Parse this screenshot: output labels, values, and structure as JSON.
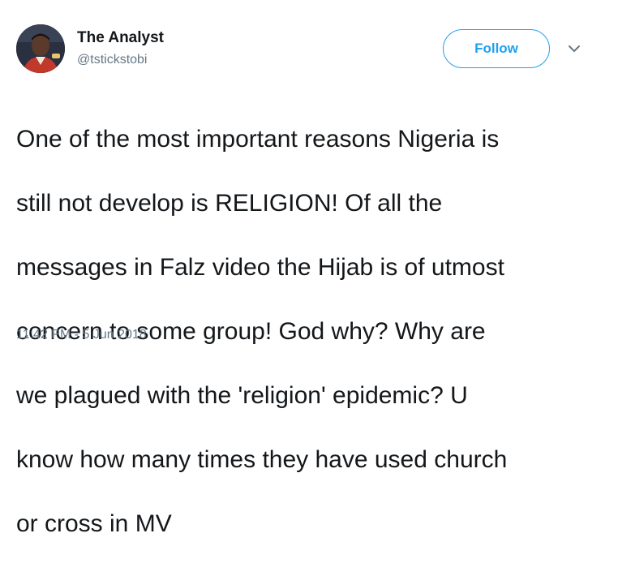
{
  "author": {
    "name": "The Analyst",
    "handle": "@tstickstobi",
    "avatar_icon": "profile-photo"
  },
  "actions": {
    "follow_label": "Follow",
    "menu_icon": "chevron-down-icon"
  },
  "tweet": {
    "lines": [
      "One of the most important reasons Nigeria is",
      "still not develop is RELIGION! Of all the",
      "messages in Falz video the Hijab is of utmost",
      "concern to some group! God why? Why are",
      "we plagued with the 'religion' epidemic? U",
      "know how many times they have used church",
      "or cross in MV"
    ],
    "timestamp": "11:42 PM - 5 Jun 2018"
  },
  "colors": {
    "accent": "#1da1f2",
    "text": "#14171a",
    "muted": "#657786"
  }
}
